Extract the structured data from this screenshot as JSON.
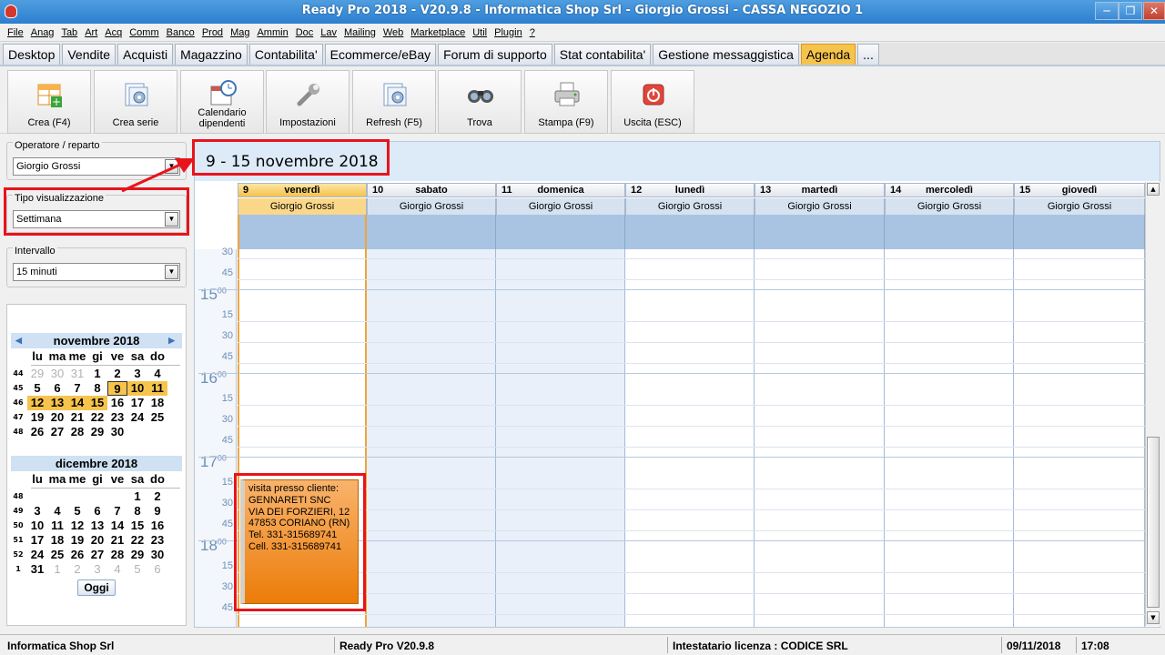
{
  "window": {
    "title": "Ready Pro 2018 - V20.9.8 - Informatica Shop Srl - Giorgio Grossi - CASSA NEGOZIO 1"
  },
  "menu": [
    "File",
    "Anag",
    "Tab",
    "Art",
    "Acq",
    "Comm",
    "Banco",
    "Prod",
    "Mag",
    "Ammin",
    "Doc",
    "Lav",
    "Mailing",
    "Web",
    "Marketplace",
    "Util",
    "Plugin",
    "?"
  ],
  "tabs": [
    {
      "label": "Desktop"
    },
    {
      "label": "Vendite"
    },
    {
      "label": "Acquisti"
    },
    {
      "label": "Magazzino"
    },
    {
      "label": "Contabilita'"
    },
    {
      "label": "Ecommerce/eBay"
    },
    {
      "label": "Forum di supporto"
    },
    {
      "label": "Stat contabilita'"
    },
    {
      "label": "Gestione messaggistica"
    },
    {
      "label": "Agenda",
      "active": true
    },
    {
      "label": "..."
    }
  ],
  "toolbar": [
    {
      "label": "Crea (F4)",
      "icon": "calendar-add-icon"
    },
    {
      "label": "Crea serie",
      "icon": "series-gear-icon"
    },
    {
      "label": "Calendario dipendenti",
      "icon": "calendar-clock-icon"
    },
    {
      "label": "Impostazioni",
      "icon": "wrench-icon"
    },
    {
      "label": "Refresh (F5)",
      "icon": "refresh-gear-icon"
    },
    {
      "label": "Trova",
      "icon": "binoculars-icon"
    },
    {
      "label": "Stampa (F9)",
      "icon": "printer-icon"
    },
    {
      "label": "Uscita (ESC)",
      "icon": "power-icon"
    }
  ],
  "sidebar": {
    "operator": {
      "caption": "Operatore / reparto",
      "value": "Giorgio Grossi"
    },
    "view": {
      "caption": "Tipo visualizzazione",
      "value": "Settimana"
    },
    "interval": {
      "caption": "Intervallo",
      "value": "15 minuti"
    }
  },
  "minical": {
    "dow": [
      "lu",
      "ma",
      "me",
      "gi",
      "ve",
      "sa",
      "do"
    ],
    "months": [
      {
        "title": "novembre 2018",
        "weeks": [
          {
            "wk": "44",
            "days": [
              {
                "d": "29",
                "o": true
              },
              {
                "d": "30",
                "o": true
              },
              {
                "d": "31",
                "o": true
              },
              {
                "d": "1"
              },
              {
                "d": "2"
              },
              {
                "d": "3"
              },
              {
                "d": "4"
              }
            ]
          },
          {
            "wk": "45",
            "days": [
              {
                "d": "5"
              },
              {
                "d": "6"
              },
              {
                "d": "7"
              },
              {
                "d": "8"
              },
              {
                "d": "9",
                "today": true
              },
              {
                "d": "10",
                "sel": true
              },
              {
                "d": "11",
                "sel": true
              }
            ]
          },
          {
            "wk": "46",
            "days": [
              {
                "d": "12",
                "sel": true
              },
              {
                "d": "13",
                "sel": true
              },
              {
                "d": "14",
                "sel": true
              },
              {
                "d": "15",
                "sel": true
              },
              {
                "d": "16"
              },
              {
                "d": "17"
              },
              {
                "d": "18"
              }
            ]
          },
          {
            "wk": "47",
            "days": [
              {
                "d": "19"
              },
              {
                "d": "20"
              },
              {
                "d": "21"
              },
              {
                "d": "22"
              },
              {
                "d": "23"
              },
              {
                "d": "24"
              },
              {
                "d": "25"
              }
            ]
          },
          {
            "wk": "48",
            "days": [
              {
                "d": "26"
              },
              {
                "d": "27"
              },
              {
                "d": "28"
              },
              {
                "d": "29"
              },
              {
                "d": "30"
              },
              {
                "d": ""
              },
              {
                "d": ""
              }
            ]
          }
        ]
      },
      {
        "title": "dicembre 2018",
        "weeks": [
          {
            "wk": "48",
            "days": [
              {
                "d": ""
              },
              {
                "d": ""
              },
              {
                "d": ""
              },
              {
                "d": ""
              },
              {
                "d": ""
              },
              {
                "d": "1"
              },
              {
                "d": "2"
              }
            ]
          },
          {
            "wk": "49",
            "days": [
              {
                "d": "3"
              },
              {
                "d": "4"
              },
              {
                "d": "5"
              },
              {
                "d": "6"
              },
              {
                "d": "7"
              },
              {
                "d": "8"
              },
              {
                "d": "9"
              }
            ]
          },
          {
            "wk": "50",
            "days": [
              {
                "d": "10"
              },
              {
                "d": "11"
              },
              {
                "d": "12"
              },
              {
                "d": "13"
              },
              {
                "d": "14"
              },
              {
                "d": "15"
              },
              {
                "d": "16"
              }
            ]
          },
          {
            "wk": "51",
            "days": [
              {
                "d": "17"
              },
              {
                "d": "18"
              },
              {
                "d": "19"
              },
              {
                "d": "20"
              },
              {
                "d": "21"
              },
              {
                "d": "22"
              },
              {
                "d": "23"
              }
            ]
          },
          {
            "wk": "52",
            "days": [
              {
                "d": "24"
              },
              {
                "d": "25"
              },
              {
                "d": "26"
              },
              {
                "d": "27"
              },
              {
                "d": "28"
              },
              {
                "d": "29"
              },
              {
                "d": "30"
              }
            ]
          },
          {
            "wk": "1",
            "days": [
              {
                "d": "31"
              },
              {
                "d": "1",
                "o": true
              },
              {
                "d": "2",
                "o": true
              },
              {
                "d": "3",
                "o": true
              },
              {
                "d": "4",
                "o": true
              },
              {
                "d": "5",
                "o": true
              },
              {
                "d": "6",
                "o": true
              }
            ]
          }
        ]
      }
    ],
    "today_label": "Oggi"
  },
  "calendar": {
    "range_title": "9 - 15 novembre 2018",
    "columns": [
      {
        "num": "9",
        "weekday": "venerdì",
        "operator": "Giorgio Grossi",
        "today": true
      },
      {
        "num": "10",
        "weekday": "sabato",
        "operator": "Giorgio Grossi",
        "weekend": true
      },
      {
        "num": "11",
        "weekday": "domenica",
        "operator": "Giorgio Grossi",
        "weekend": true
      },
      {
        "num": "12",
        "weekday": "lunedì",
        "operator": "Giorgio Grossi"
      },
      {
        "num": "13",
        "weekday": "martedì",
        "operator": "Giorgio Grossi"
      },
      {
        "num": "14",
        "weekday": "mercoledì",
        "operator": "Giorgio Grossi"
      },
      {
        "num": "15",
        "weekday": "giovedì",
        "operator": "Giorgio Grossi"
      }
    ],
    "time_slots": [
      {
        "m": "30"
      },
      {
        "m": "45"
      },
      {
        "h": "15",
        "m": "00"
      },
      {
        "m": "15"
      },
      {
        "m": "30"
      },
      {
        "m": "45"
      },
      {
        "h": "16",
        "m": "00"
      },
      {
        "m": "15"
      },
      {
        "m": "30"
      },
      {
        "m": "45"
      },
      {
        "h": "17",
        "m": "00"
      },
      {
        "m": "15"
      },
      {
        "m": "30"
      },
      {
        "m": "45"
      },
      {
        "h": "18",
        "m": "00"
      },
      {
        "m": "15"
      },
      {
        "m": "30"
      },
      {
        "m": "45"
      }
    ],
    "appointment": {
      "lines": [
        "visita presso cliente:",
        "GENNARETI SNC",
        "VIA DEI FORZIERI, 12",
        "47853 CORIANO (RN)",
        "Tel. 331-315689741",
        "Cell. 331-315689741"
      ]
    }
  },
  "statusbar": {
    "company": "Informatica Shop Srl",
    "version": "Ready Pro V20.9.8",
    "license": "Intestatario licenza : CODICE SRL",
    "date": "09/11/2018",
    "time": "17:08"
  },
  "colors": {
    "accent": "#f6c44d",
    "highlight": "#e8141b",
    "appointment": "#ec7c08"
  }
}
